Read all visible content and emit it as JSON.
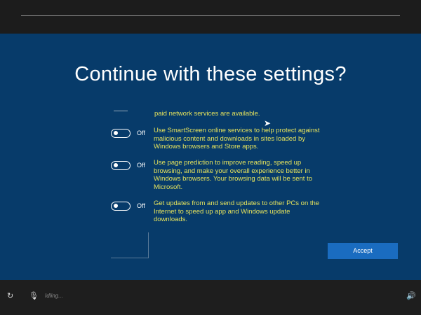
{
  "title": "Continue with these settings?",
  "partial_text": "paid network services are available.",
  "settings": [
    {
      "state": "Off",
      "text": "Use SmartScreen online services to help protect against malicious content and downloads in sites loaded by Windows browsers and Store apps."
    },
    {
      "state": "Off",
      "text": "Use page prediction to improve reading, speed up browsing, and make your overall experience better in Windows browsers. Your browsing data will be sent to Microsoft."
    },
    {
      "state": "Off",
      "text": "Get updates from and send updates to other PCs on the Internet to speed up app and Windows update downloads."
    }
  ],
  "accept_label": "Accept",
  "status": "Idling...",
  "colors": {
    "background": "#073b6a",
    "accent": "#1a6cc0",
    "text": "#e6e35c"
  }
}
